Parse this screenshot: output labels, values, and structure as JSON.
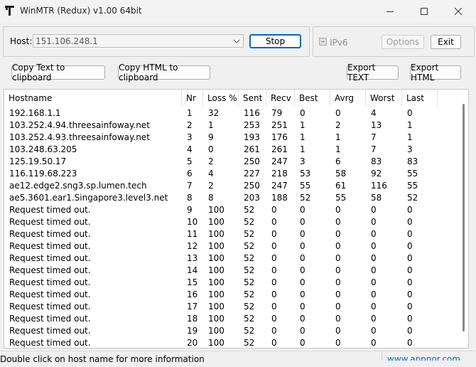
{
  "window": {
    "title": "WinMTR (Redux) v1.00 64bit"
  },
  "host": {
    "label": "Host:",
    "value": "151.106.248.1"
  },
  "buttons": {
    "stop": "Stop",
    "options": "Options",
    "exit": "Exit",
    "copy_text": "Copy Text to clipboard",
    "copy_html": "Copy HTML to clipboard",
    "export_text": "Export TEXT",
    "export_html": "Export HTML"
  },
  "ipv6": {
    "label": "IPv6"
  },
  "table": {
    "columns": [
      "Hostname",
      "Nr",
      "Loss %",
      "Sent",
      "Recv",
      "Best",
      "Avrg",
      "Worst",
      "Last"
    ],
    "rows": [
      [
        "192.168.1.1",
        "1",
        "32",
        "116",
        "79",
        "0",
        "0",
        "4",
        "0"
      ],
      [
        "103.252.4.94.threesainfoway.net",
        "2",
        "1",
        "253",
        "251",
        "1",
        "2",
        "13",
        "1"
      ],
      [
        "103.252.4.93.threesainfoway.net",
        "3",
        "9",
        "193",
        "176",
        "1",
        "1",
        "7",
        "1"
      ],
      [
        "103.248.63.205",
        "4",
        "0",
        "261",
        "261",
        "1",
        "1",
        "7",
        "3"
      ],
      [
        "125.19.50.17",
        "5",
        "2",
        "250",
        "247",
        "3",
        "6",
        "83",
        "83"
      ],
      [
        "116.119.68.223",
        "6",
        "4",
        "227",
        "218",
        "53",
        "58",
        "92",
        "55"
      ],
      [
        "ae12.edge2.sng3.sp.lumen.tech",
        "7",
        "2",
        "250",
        "247",
        "55",
        "61",
        "116",
        "55"
      ],
      [
        "ae5.3601.ear1.Singapore3.level3.net",
        "8",
        "8",
        "203",
        "188",
        "52",
        "55",
        "58",
        "52"
      ],
      [
        "Request timed out.",
        "9",
        "100",
        "52",
        "0",
        "0",
        "0",
        "0",
        "0"
      ],
      [
        "Request timed out.",
        "10",
        "100",
        "52",
        "0",
        "0",
        "0",
        "0",
        "0"
      ],
      [
        "Request timed out.",
        "11",
        "100",
        "52",
        "0",
        "0",
        "0",
        "0",
        "0"
      ],
      [
        "Request timed out.",
        "12",
        "100",
        "52",
        "0",
        "0",
        "0",
        "0",
        "0"
      ],
      [
        "Request timed out.",
        "13",
        "100",
        "52",
        "0",
        "0",
        "0",
        "0",
        "0"
      ],
      [
        "Request timed out.",
        "14",
        "100",
        "52",
        "0",
        "0",
        "0",
        "0",
        "0"
      ],
      [
        "Request timed out.",
        "15",
        "100",
        "52",
        "0",
        "0",
        "0",
        "0",
        "0"
      ],
      [
        "Request timed out.",
        "16",
        "100",
        "52",
        "0",
        "0",
        "0",
        "0",
        "0"
      ],
      [
        "Request timed out.",
        "17",
        "100",
        "52",
        "0",
        "0",
        "0",
        "0",
        "0"
      ],
      [
        "Request timed out.",
        "18",
        "100",
        "52",
        "0",
        "0",
        "0",
        "0",
        "0"
      ],
      [
        "Request timed out.",
        "19",
        "100",
        "52",
        "0",
        "0",
        "0",
        "0",
        "0"
      ],
      [
        "Request timed out.",
        "20",
        "100",
        "52",
        "0",
        "0",
        "0",
        "0",
        "0"
      ]
    ]
  },
  "status": {
    "hint": "Double click on host name for more information",
    "link": "www.appnor.com"
  },
  "icons": {
    "app": "winmtr-app-icon",
    "minimize": "minimize-icon",
    "maximize": "maximize-icon",
    "close": "close-icon",
    "dropdown": "chevron-down-icon"
  },
  "colors": {
    "accent": "#0067c0",
    "link": "#0066cc"
  }
}
